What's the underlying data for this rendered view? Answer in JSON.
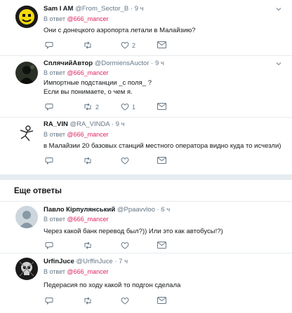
{
  "tweets": [
    {
      "name": "Sam I AM",
      "handle": "@From_Sector_B",
      "time": "9 ч",
      "reply_prefix": "В ответ",
      "reply_to": "@666_mancer",
      "lines": [
        "Они с донецкого аэропорта летали в Малайзию?"
      ],
      "reply_count": "",
      "retweet_count": "",
      "like_count": "2",
      "avatar": "smiley"
    },
    {
      "name": "СплячийАвтор",
      "handle": "@DormiensAuctor",
      "time": "9 ч",
      "reply_prefix": "В ответ",
      "reply_to": "@666_mancer",
      "lines": [
        "Импортные подстанции _с поля_ ?",
        "Если вы понимаете, о чем я."
      ],
      "reply_count": "",
      "retweet_count": "2",
      "like_count": "1",
      "avatar": "dark"
    },
    {
      "name": "RA_VIN",
      "handle": "@RA_VINDA",
      "time": "9 ч",
      "reply_prefix": "В ответ",
      "reply_to": "@666_mancer",
      "lines": [
        "в Малайзии 20 базовых станций местного оператора видно куда то исчезли)"
      ],
      "reply_count": "",
      "retweet_count": "",
      "like_count": "",
      "avatar": "figure"
    },
    {
      "name": "Павло Кiрпулянський",
      "handle": "@Ppaavvloo",
      "time": "6 ч",
      "reply_prefix": "В ответ",
      "reply_to": "@666_mancer",
      "lines": [
        "Через какой банк перевод был?)) Или это как автобусы!?)"
      ],
      "reply_count": "",
      "retweet_count": "",
      "like_count": "",
      "avatar": "default"
    },
    {
      "name": "UrfinJuce",
      "handle": "@UrffinJuce",
      "time": "7 ч",
      "reply_prefix": "В ответ",
      "reply_to": "@666_mancer",
      "lines": [
        "Педерасия по ходу какой то подгон сделала"
      ],
      "reply_count": "",
      "retweet_count": "",
      "like_count": "",
      "avatar": "skull"
    }
  ],
  "more_replies": "Еще ответы",
  "colors": {
    "accent": "#e0245e",
    "muted": "#657786",
    "border": "#e6ecf0"
  },
  "icons": {
    "reply": "reply-icon",
    "retweet": "retweet-icon",
    "like": "heart-icon",
    "dm": "envelope-icon",
    "more": "chevron-down-icon"
  }
}
